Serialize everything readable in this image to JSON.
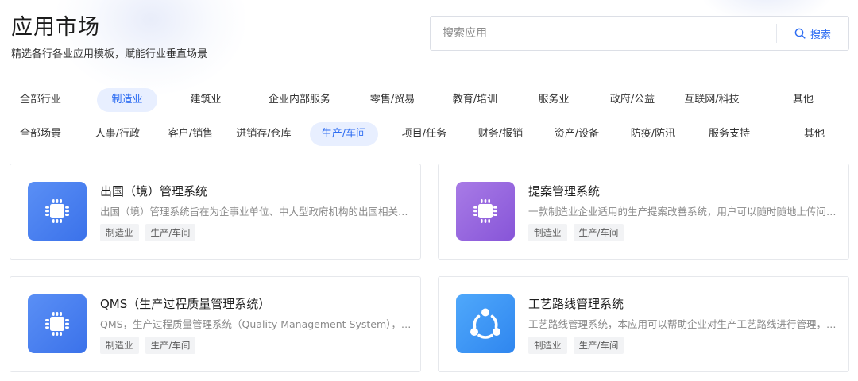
{
  "header": {
    "title": "应用市场",
    "subtitle": "精选各行各业应用模板，赋能行业垂直场景"
  },
  "search": {
    "placeholder": "搜索应用",
    "button_label": "搜索",
    "button_icon": "search-icon"
  },
  "colors": {
    "accent": "#2f6ef2",
    "active_bg": "#e8efff",
    "tag_bg": "#f2f3f5"
  },
  "industry_filters": {
    "active": "制造业",
    "items": [
      "全部行业",
      "制造业",
      "建筑业",
      "企业内部服务",
      "零售/贸易",
      "教育/培训",
      "服务业",
      "政府/公益",
      "互联网/科技",
      "其他"
    ]
  },
  "scene_filters": {
    "active": "生产/车间",
    "items": [
      "全部场景",
      "人事/行政",
      "客户/销售",
      "进销存/仓库",
      "生产/车间",
      "项目/任务",
      "财务/报销",
      "资产/设备",
      "防疫/防汛",
      "服务支持",
      "其他"
    ]
  },
  "apps": [
    {
      "name": "出国（境）管理系统",
      "description": "出国（境）管理系统旨在为企事业单位、中大型政府机构的出国相关工作提供全流程管理服务",
      "tags": [
        "制造业",
        "生产/车间"
      ],
      "icon": "chip-icon",
      "icon_color": "#4a80f0"
    },
    {
      "name": "提案管理系统",
      "description": "一款制造业企业适用的生产提案改善系统，用户可以随时随地上传问题与改善提案",
      "tags": [
        "制造业",
        "生产/车间"
      ],
      "icon": "chip-icon",
      "icon_color": "#9566de"
    },
    {
      "name": "QMS（生产过程质量管理系统）",
      "description": "QMS，生产过程质量管理系统（Quality Management System），覆盖生产全过程",
      "tags": [
        "制造业",
        "生产/车间"
      ],
      "icon": "chip-icon",
      "icon_color": "#4a80f0"
    },
    {
      "name": "工艺路线管理系统",
      "description": "工艺路线管理系统，本应用可以帮助企业对生产工艺路线进行管理，提升生产效率",
      "tags": [
        "制造业",
        "生产/车间"
      ],
      "icon": "share-nodes-icon",
      "icon_color": "#3d96f5"
    }
  ]
}
